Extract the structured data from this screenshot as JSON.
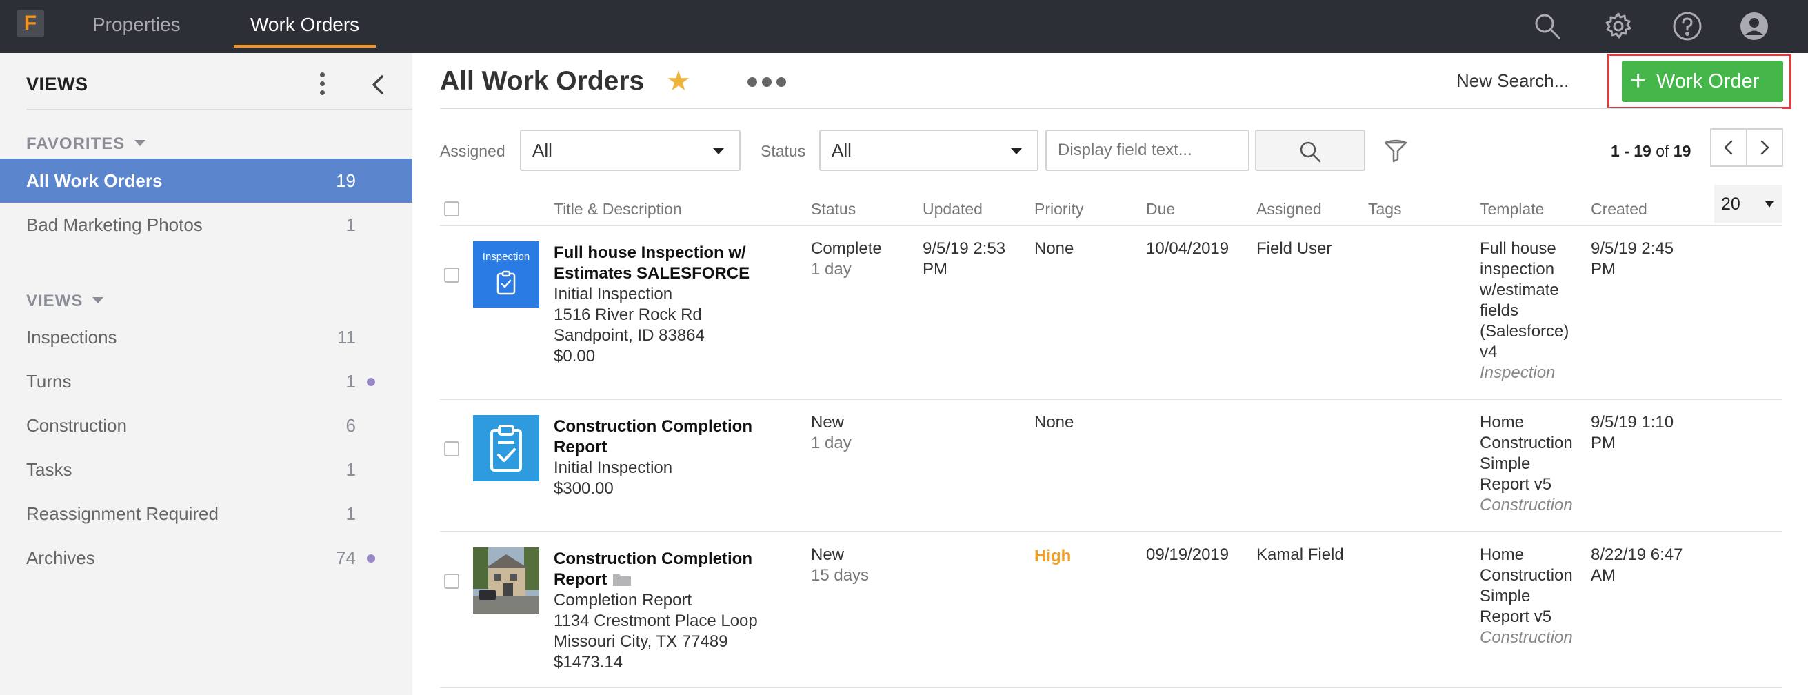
{
  "app": {
    "logo_letter": "F",
    "nav_tabs": [
      "Properties",
      "Work Orders"
    ],
    "icons": [
      "search-icon",
      "gear-icon",
      "help-icon",
      "user-icon"
    ]
  },
  "sidebar": {
    "header": "VIEWS",
    "favorites_label": "FAVORITES",
    "views_label": "VIEWS",
    "favorites": [
      {
        "label": "All Work Orders",
        "count": "19"
      },
      {
        "label": "Bad Marketing Photos",
        "count": "1"
      }
    ],
    "views": [
      {
        "label": "Inspections",
        "count": "11"
      },
      {
        "label": "Turns",
        "count": "1"
      },
      {
        "label": "Construction",
        "count": "6"
      },
      {
        "label": "Tasks",
        "count": "1"
      },
      {
        "label": "Reassignment Required",
        "count": "1"
      },
      {
        "label": "Archives",
        "count": "74"
      }
    ]
  },
  "main": {
    "title": "All Work Orders",
    "new_search": "New Search...",
    "new_button": "Work Order",
    "filters": {
      "assigned_label": "Assigned",
      "assigned_value": "All",
      "status_label": "Status",
      "status_value": "All",
      "text_placeholder": "Display field text..."
    },
    "pager": {
      "range": "1 - 19",
      "of_label": "of",
      "total": "19"
    },
    "per_page": "20",
    "columns": [
      "Title & Description",
      "Status",
      "Updated",
      "Priority",
      "Due",
      "Assigned",
      "Tags",
      "Template",
      "Created"
    ],
    "rows": [
      {
        "thumb_label": "Inspection",
        "title_1": "Full house Inspection w/",
        "title_2": "Estimates SALESFORCE",
        "desc": [
          "Initial Inspection",
          "1516 River Rock Rd",
          "Sandpoint, ID 83864",
          "$0.00"
        ],
        "status": "Complete",
        "status_age": "1 day",
        "updated_1": "9/5/19 2:53",
        "updated_2": "PM",
        "priority": "None",
        "due": "10/04/2019",
        "assigned": "Field User",
        "template": [
          "Full house",
          "inspection",
          "w/estimate",
          "fields",
          "(Salesforce)",
          "v4"
        ],
        "template_type": "Inspection",
        "created_1": "9/5/19 2:45",
        "created_2": "PM"
      },
      {
        "title_1": "Construction Completion",
        "title_2": "Report",
        "desc": [
          "Initial Inspection",
          "$300.00"
        ],
        "status": "New",
        "status_age": "1 day",
        "priority": "None",
        "template": [
          "Home",
          "Construction",
          "Simple",
          "Report v5"
        ],
        "template_type": "Construction",
        "created_1": "9/5/19 1:10",
        "created_2": "PM"
      },
      {
        "title_1": "Construction Completion",
        "title_2": "Report",
        "desc": [
          "Completion Report",
          "1134 Crestmont Place Loop",
          "Missouri City, TX 77489",
          "$1473.14"
        ],
        "status": "New",
        "status_age": "15 days",
        "priority": "High",
        "due": "09/19/2019",
        "assigned": "Kamal Field",
        "template": [
          "Home",
          "Construction",
          "Simple",
          "Report v5"
        ],
        "template_type": "Construction",
        "created_1": "8/22/19 6:47",
        "created_2": "AM"
      }
    ]
  },
  "colors": {
    "topbar": "#2d2f36",
    "accent_orange": "#f4931e",
    "sidebar_active": "#5b86cd",
    "button_green": "#45b649",
    "priority_high": "#f0a025",
    "highlight_red": "#e23b3b"
  }
}
